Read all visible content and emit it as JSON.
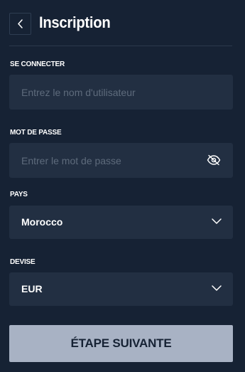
{
  "header": {
    "title": "Inscription"
  },
  "form": {
    "username": {
      "label": "SE CONNECTER",
      "placeholder": "Entrez le nom d'utilisateur",
      "value": ""
    },
    "password": {
      "label": "MOT DE PASSE",
      "placeholder": "Entrer le mot de passe",
      "value": "",
      "toggle_icon": "eye-slash-icon"
    },
    "country": {
      "label": "PAYS",
      "selected": "Morocco"
    },
    "currency": {
      "label": "DEVISE",
      "selected": "EUR"
    }
  },
  "actions": {
    "next_label": "ÉTAPE SUIVANTE"
  },
  "colors": {
    "background": "#162234",
    "field_background": "#222f42",
    "button_background": "#a8b2c4",
    "button_text": "#162234"
  }
}
